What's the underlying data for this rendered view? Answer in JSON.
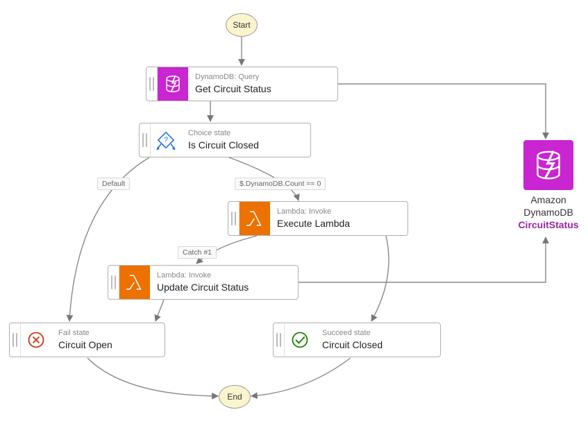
{
  "terminals": {
    "start": "Start",
    "end": "End"
  },
  "nodes": {
    "getCircuit": {
      "subtitle": "DynamoDB: Query",
      "title": "Get Circuit Status"
    },
    "choice": {
      "subtitle": "Choice state",
      "title": "Is Circuit Closed"
    },
    "execLambda": {
      "subtitle": "Lambda: Invoke",
      "title": "Execute Lambda"
    },
    "updateCircuit": {
      "subtitle": "Lambda: Invoke",
      "title": "Update Circuit Status"
    },
    "fail": {
      "subtitle": "Fail state",
      "title": "Circuit Open"
    },
    "succeed": {
      "subtitle": "Succeed state",
      "title": "Circuit Closed"
    }
  },
  "edgeLabels": {
    "default": "Default",
    "condition": "$.DynamoDB.Count == 0",
    "catch": "Catch #1"
  },
  "resource": {
    "line1": "Amazon",
    "line2": "DynamoDB",
    "line3": "CircuitStatus"
  }
}
